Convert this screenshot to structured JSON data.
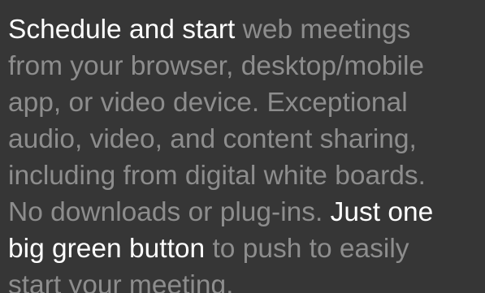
{
  "description": {
    "lines": [
      {
        "segments": [
          {
            "text": "Schedule and start",
            "highlight": true
          },
          {
            "text": " web meetings",
            "highlight": false
          }
        ]
      },
      {
        "segments": [
          {
            "text": "from your browser, desktop/mobile",
            "highlight": false
          }
        ]
      },
      {
        "segments": [
          {
            "text": "app, or video device. Exceptional",
            "highlight": false
          }
        ]
      },
      {
        "segments": [
          {
            "text": "audio, video, and content sharing,",
            "highlight": false
          }
        ]
      },
      {
        "segments": [
          {
            "text": "including from digital white boards.",
            "highlight": false
          }
        ]
      },
      {
        "segments": [
          {
            "text": "No downloads or plug-ins. ",
            "highlight": false
          },
          {
            "text": "Just one",
            "highlight": true
          }
        ]
      },
      {
        "segments": [
          {
            "text": "big green button",
            "highlight": true
          },
          {
            "text": " to push to easily",
            "highlight": false
          }
        ]
      },
      {
        "segments": [
          {
            "text": "start your meeting.",
            "highlight": false
          }
        ]
      }
    ]
  },
  "colors": {
    "background": "#363636",
    "text_muted": "#8d8d8d",
    "text_highlight": "#ffffff"
  }
}
